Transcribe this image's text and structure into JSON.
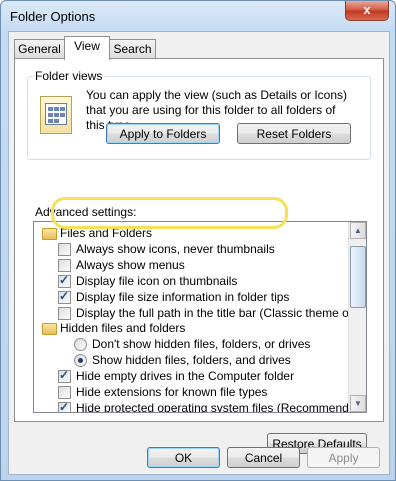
{
  "window": {
    "title": "Folder Options",
    "close_label": "x"
  },
  "tabs": [
    "General",
    "View",
    "Search"
  ],
  "folder_views": {
    "group_label": "Folder views",
    "description": "You can apply the view (such as Details or Icons) that you are using for this folder to all folders of this type.",
    "apply_label": "Apply to Folders",
    "reset_label": "Reset Folders"
  },
  "advanced": {
    "label": "Advanced settings:",
    "items": [
      {
        "type": "folder",
        "label": "Files and Folders"
      },
      {
        "type": "checkbox",
        "checked": false,
        "label": "Always show icons, never thumbnails"
      },
      {
        "type": "checkbox",
        "checked": false,
        "label": "Always show menus"
      },
      {
        "type": "checkbox",
        "checked": true,
        "label": "Display file icon on thumbnails"
      },
      {
        "type": "checkbox",
        "checked": true,
        "label": "Display file size information in folder tips"
      },
      {
        "type": "checkbox",
        "checked": false,
        "label": "Display the full path in the title bar (Classic theme only)"
      },
      {
        "type": "folder",
        "label": "Hidden files and folders"
      },
      {
        "type": "radio",
        "checked": false,
        "label": "Don't show hidden files, folders, or drives"
      },
      {
        "type": "radio",
        "checked": true,
        "label": "Show hidden files, folders, and drives"
      },
      {
        "type": "checkbox",
        "checked": true,
        "label": "Hide empty drives in the Computer folder"
      },
      {
        "type": "checkbox",
        "checked": false,
        "label": "Hide extensions for known file types"
      },
      {
        "type": "checkbox",
        "checked": true,
        "label": "Hide protected operating system files (Recommended)"
      }
    ],
    "restore_label": "Restore Defaults"
  },
  "footer": {
    "ok": "OK",
    "cancel": "Cancel",
    "apply": "Apply"
  }
}
